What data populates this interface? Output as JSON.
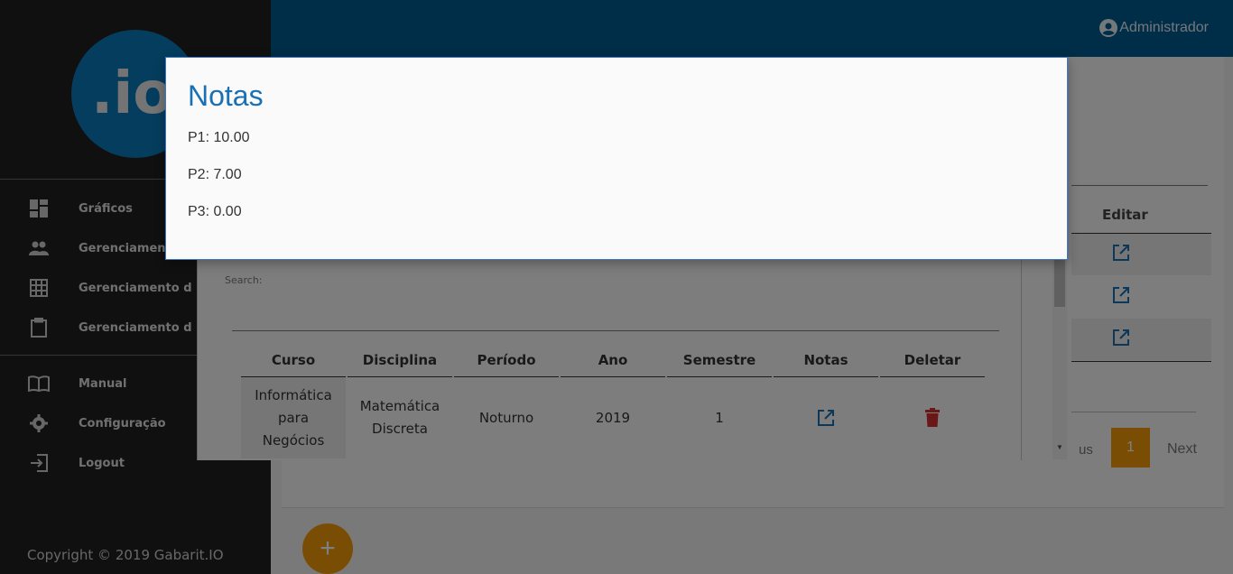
{
  "app": {
    "logo_text": ".io",
    "copyright": "Copyright © 2019 Gabarit.IO"
  },
  "header": {
    "user_name": "Administrador"
  },
  "sidebar": {
    "items": [
      {
        "label": "Gráficos",
        "icon": "dashboard-icon"
      },
      {
        "label": "Gerenciamento",
        "icon": "people-icon"
      },
      {
        "label": "Gerenciamento d",
        "icon": "grid-icon"
      },
      {
        "label": "Gerenciamento d",
        "icon": "clipboard-icon"
      },
      {
        "label": "Manual",
        "icon": "book-icon"
      },
      {
        "label": "Configuração",
        "icon": "gear-icon"
      },
      {
        "label": "Logout",
        "icon": "logout-icon"
      }
    ]
  },
  "background": {
    "editar_header": "Editar",
    "pager": {
      "prev": "us",
      "current": "1",
      "next": "Next"
    },
    "fab_label": "+"
  },
  "dialog2": {
    "search_label": "Search:",
    "columns": [
      "Curso",
      "Disciplina",
      "Período",
      "Ano",
      "Semestre",
      "Notas",
      "Deletar"
    ],
    "row": {
      "curso": "Informática para Negócios",
      "disciplina": "Matemática Discreta",
      "periodo": "Noturno",
      "ano": "2019",
      "semestre": "1"
    }
  },
  "modal": {
    "title": "Notas",
    "grades": [
      "P1: 10.00",
      "P2: 7.00",
      "P3: 0.00"
    ]
  },
  "colors": {
    "accent": "#1a70b4",
    "topbar": "#005a8e",
    "sidebar": "#212121",
    "orange": "#f59a0b",
    "delete": "#d32f2f"
  }
}
